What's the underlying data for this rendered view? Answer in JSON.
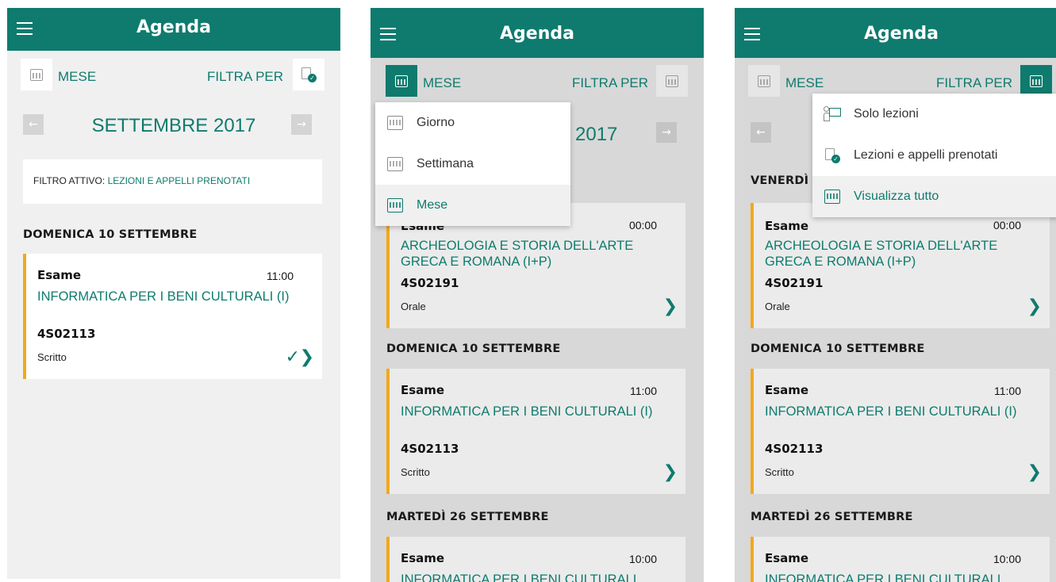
{
  "screens": [
    {
      "title": "Agenda",
      "view_label": "MESE",
      "filter_label": "FILTRA PER",
      "month": "SETTEMBRE 2017",
      "prev": "←",
      "next": "→",
      "active_filter_prefix": "FILTRO ATTIVO:",
      "active_filter_value": "LEZIONI E APPELLI PRENOTATI",
      "day1": "DOMENICA 10 SETTEMBRE",
      "card1": {
        "type": "Esame",
        "time": "11:00",
        "course": "INFORMATICA PER I BENI CULTURALI (I)",
        "code": "4S02113",
        "mode": "Scritto",
        "check": "✓",
        "chev": "❯"
      }
    },
    {
      "title": "Agenda",
      "view_label": "MESE",
      "filter_label": "FILTRA PER",
      "month_partial": "2017",
      "next": "→",
      "menu": [
        "Giorno",
        "Settimana",
        "Mese"
      ],
      "card0": {
        "type": "Esame",
        "time": "00:00",
        "course": "ARCHEOLOGIA E STORIA DELL'ARTE GRECA E ROMANA (I+P)",
        "code": "4S02191",
        "mode": "Orale",
        "chev": "❯"
      },
      "day1": "DOMENICA 10 SETTEMBRE",
      "card1": {
        "type": "Esame",
        "time": "11:00",
        "course": "INFORMATICA PER I BENI CULTURALI (I)",
        "code": "4S02113",
        "mode": "Scritto",
        "chev": "❯"
      },
      "day2": "MARTEDÌ 26 SETTEMBRE",
      "card2": {
        "type": "Esame",
        "time": "10:00",
        "course": "INFORMATICA PER I BENI CULTURALI"
      }
    },
    {
      "title": "Agenda",
      "view_label": "MESE",
      "filter_label": "FILTRA PER",
      "prev": "←",
      "day0": "VENERDÌ",
      "menu": [
        "Solo lezioni",
        "Lezioni e appelli prenotati",
        "Visualizza tutto"
      ],
      "card0": {
        "type": "Esame",
        "time": "00:00",
        "course": "ARCHEOLOGIA E STORIA DELL'ARTE GRECA E ROMANA (I+P)",
        "code": "4S02191",
        "mode": "Orale",
        "chev": "❯"
      },
      "day1": "DOMENICA 10 SETTEMBRE",
      "card1": {
        "type": "Esame",
        "time": "11:00",
        "course": "INFORMATICA PER I BENI CULTURALI (I)",
        "code": "4S02113",
        "mode": "Scritto",
        "chev": "❯"
      },
      "day2": "MARTEDÌ 26 SETTEMBRE",
      "card2": {
        "type": "Esame",
        "time": "10:00",
        "course": "INFORMATICA PER I BENI CULTURALI"
      }
    }
  ],
  "colors": {
    "primary": "#0e7b6e",
    "accent": "#f4a81c"
  },
  "icons": {
    "menu": "hamburger-icon",
    "calendar": "calendar-icon",
    "filter": "filter-check-icon",
    "lesson": "lesson-icon"
  }
}
